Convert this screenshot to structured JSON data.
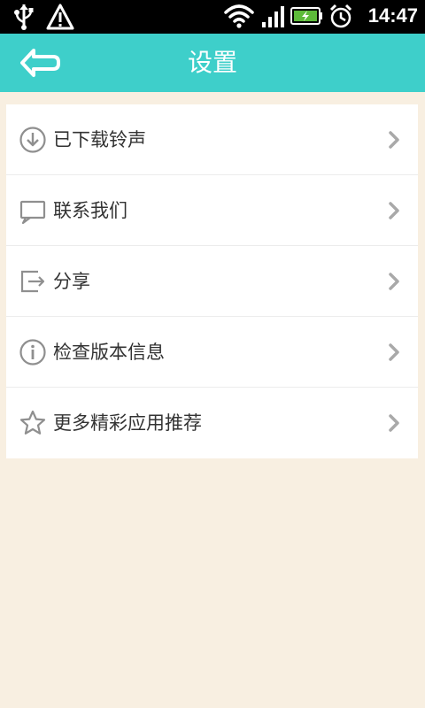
{
  "status_bar": {
    "time": "14:47",
    "icons": [
      "usb-icon",
      "warning-icon",
      "wifi-icon",
      "signal-icon",
      "battery-icon",
      "alarm-icon"
    ]
  },
  "header": {
    "title": "设置",
    "back_icon": "back-arrow-icon",
    "background": "#3ecfca"
  },
  "settings": {
    "items": [
      {
        "label": "已下载铃声",
        "icon": "download-icon"
      },
      {
        "label": "联系我们",
        "icon": "chat-icon"
      },
      {
        "label": "分享",
        "icon": "share-icon"
      },
      {
        "label": "检查版本信息",
        "icon": "info-icon"
      },
      {
        "label": "更多精彩应用推荐",
        "icon": "star-icon"
      }
    ]
  },
  "colors": {
    "page_background": "#f8efe1",
    "list_background": "#ffffff",
    "icon_color": "#8f8f8f"
  }
}
